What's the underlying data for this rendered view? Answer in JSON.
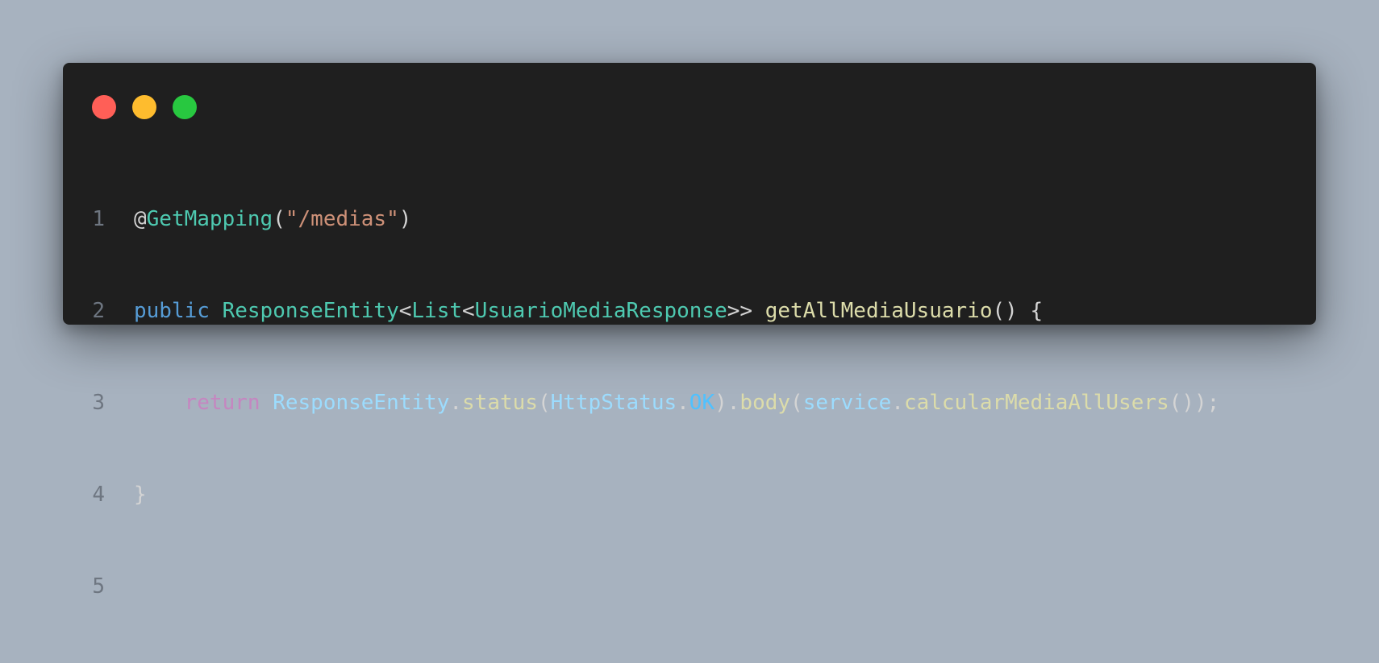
{
  "colors": {
    "background": "#a7b2bf",
    "window": "#1f1f1f",
    "dot_close": "#ff5f57",
    "dot_minimize": "#febc2e",
    "dot_maximize": "#28c840"
  },
  "window_controls": {
    "close": "close-dot",
    "minimize": "minimize-dot",
    "maximize": "maximize-dot"
  },
  "code": {
    "line_numbers": [
      "1",
      "2",
      "3",
      "4",
      "5"
    ],
    "lines": [
      {
        "tokens": [
          {
            "text": "@",
            "kind": "plain"
          },
          {
            "text": "GetMapping",
            "kind": "type"
          },
          {
            "text": "(",
            "kind": "punct"
          },
          {
            "text": "\"/medias\"",
            "kind": "string"
          },
          {
            "text": ")",
            "kind": "punct"
          }
        ]
      },
      {
        "tokens": [
          {
            "text": "public",
            "kind": "keyword"
          },
          {
            "text": " ",
            "kind": "plain"
          },
          {
            "text": "ResponseEntity",
            "kind": "type"
          },
          {
            "text": "<",
            "kind": "punct"
          },
          {
            "text": "List",
            "kind": "type"
          },
          {
            "text": "<",
            "kind": "punct"
          },
          {
            "text": "UsuarioMediaResponse",
            "kind": "type"
          },
          {
            "text": ">> ",
            "kind": "punct"
          },
          {
            "text": "getAllMediaUsuario",
            "kind": "func"
          },
          {
            "text": "() {",
            "kind": "punct"
          }
        ]
      },
      {
        "tokens": [
          {
            "text": "    ",
            "kind": "plain"
          },
          {
            "text": "return",
            "kind": "control"
          },
          {
            "text": " ",
            "kind": "plain"
          },
          {
            "text": "ResponseEntity",
            "kind": "var"
          },
          {
            "text": ".",
            "kind": "punct"
          },
          {
            "text": "status",
            "kind": "func"
          },
          {
            "text": "(",
            "kind": "punct"
          },
          {
            "text": "HttpStatus",
            "kind": "var"
          },
          {
            "text": ".",
            "kind": "punct"
          },
          {
            "text": "OK",
            "kind": "const"
          },
          {
            "text": ").",
            "kind": "punct"
          },
          {
            "text": "body",
            "kind": "func"
          },
          {
            "text": "(",
            "kind": "punct"
          },
          {
            "text": "service",
            "kind": "var"
          },
          {
            "text": ".",
            "kind": "punct"
          },
          {
            "text": "calcularMediaAllUsers",
            "kind": "func"
          },
          {
            "text": "());",
            "kind": "punct"
          }
        ]
      },
      {
        "tokens": [
          {
            "text": "}",
            "kind": "punct"
          }
        ]
      },
      {
        "tokens": []
      }
    ]
  }
}
